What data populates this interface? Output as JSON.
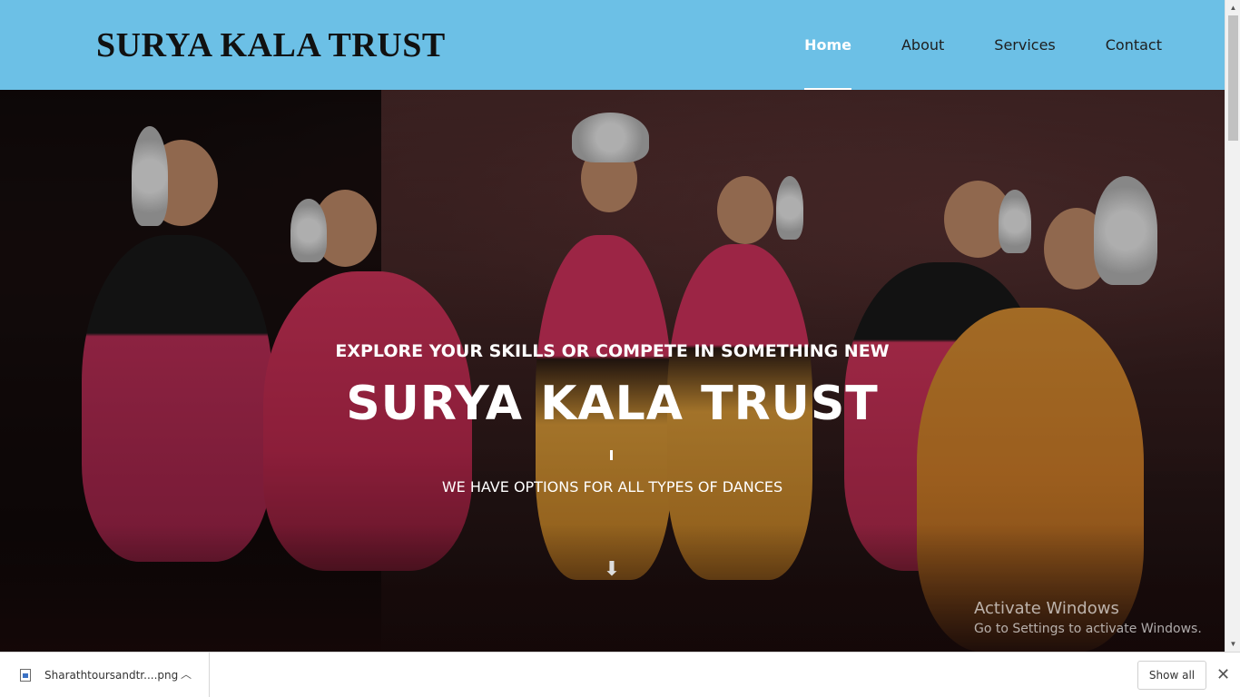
{
  "header": {
    "brand": "SURYA KALA TRUST",
    "nav": [
      {
        "label": "Home",
        "active": true
      },
      {
        "label": "About",
        "active": false
      },
      {
        "label": "Services",
        "active": false
      },
      {
        "label": "Contact",
        "active": false
      }
    ],
    "bg_color": "#6cc0e6"
  },
  "hero": {
    "eyebrow": "EXPLORE YOUR SKILLS OR COMPETE IN SOMETHING NEW",
    "title": "SURYA KALA TRUST",
    "subtitle": "WE HAVE OPTIONS FOR ALL TYPES OF DANCES",
    "scroll_icon": "arrow-down-icon"
  },
  "watermark": {
    "line1": "Activate Windows",
    "line2": "Go to Settings to activate Windows."
  },
  "download_bar": {
    "file_name": "Sharathtoursandtr....png",
    "show_all_label": "Show all"
  }
}
